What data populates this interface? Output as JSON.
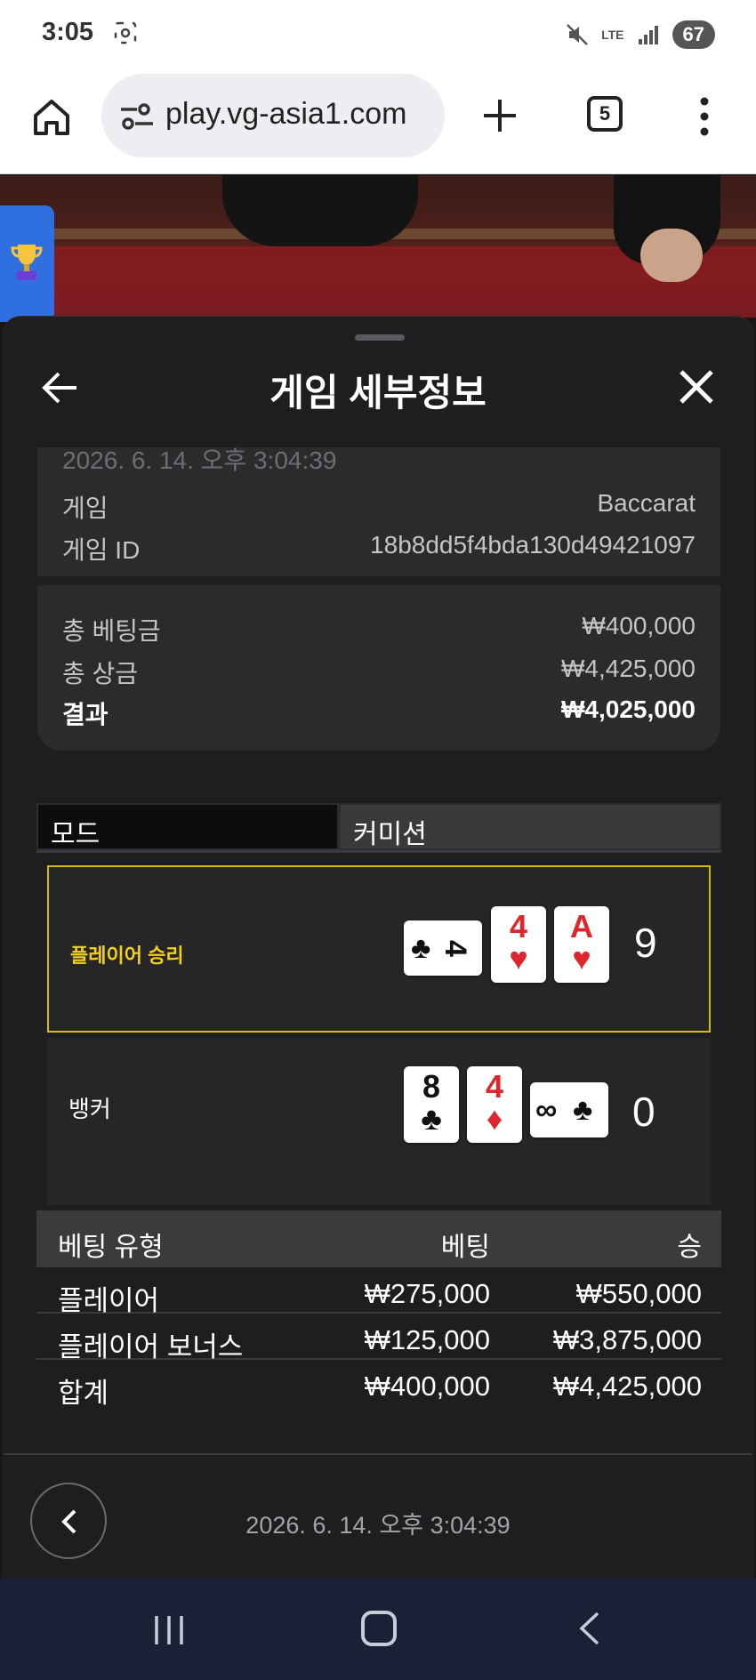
{
  "status_bar": {
    "time": "3:05",
    "battery": "67",
    "network": "LTE"
  },
  "browser": {
    "url": "play.vg-asia1.com",
    "tab_count": "5"
  },
  "sheet": {
    "title": "게임 세부정보",
    "timestamp_faded": "2026. 6. 14. 오후 3:04:39",
    "info": [
      {
        "label": "게임",
        "value": "Baccarat"
      },
      {
        "label": "게임 ID",
        "value": "18b8dd5f4bda130d49421097"
      }
    ],
    "totals": [
      {
        "label": "총 베팅금",
        "value": "₩400,000"
      },
      {
        "label": "총 상금",
        "value": "₩4,425,000"
      },
      {
        "label": "결과",
        "value": "₩4,025,000"
      }
    ],
    "tabs": {
      "mode": "모드",
      "commission": "커미션"
    },
    "outcomes": {
      "player": {
        "label": "플레이어 승리",
        "score": "9",
        "cards": [
          {
            "rank": "4",
            "suit": "♣",
            "color": "black",
            "orientation": "horizontal"
          },
          {
            "rank": "4",
            "suit": "♥",
            "color": "red"
          },
          {
            "rank": "A",
            "suit": "♥",
            "color": "red"
          }
        ]
      },
      "banker": {
        "label": "뱅커",
        "score": "0",
        "cards": [
          {
            "rank": "8",
            "suit": "♣",
            "color": "black"
          },
          {
            "rank": "4",
            "suit": "♦",
            "color": "red"
          },
          {
            "rank": "∞",
            "suit": "♣",
            "color": "black",
            "orientation": "horizontal"
          }
        ]
      }
    },
    "bets_table": {
      "headers": [
        "베팅 유형",
        "베팅",
        "승"
      ],
      "rows": [
        [
          "플레이어",
          "₩275,000",
          "₩550,000"
        ],
        [
          "플레이어 보너스",
          "₩125,000",
          "₩3,875,000"
        ],
        [
          "합계",
          "₩400,000",
          "₩4,425,000"
        ]
      ]
    },
    "footer_timestamp": "2026. 6. 14. 오후 3:04:39"
  },
  "colors": {
    "accent_yellow": "#d7b915",
    "card_red": "#e0262d",
    "sheet_bg": "#1e1e21"
  }
}
